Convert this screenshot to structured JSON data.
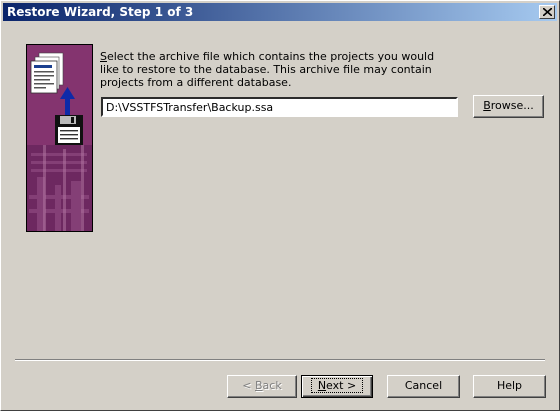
{
  "window": {
    "title": "Restore Wizard, Step 1 of 3"
  },
  "description": {
    "first_letter": "S",
    "text_rest": "elect the archive file which contains the projects you would like to restore to the database. This archive file may contain projects from a different database."
  },
  "archive_path": {
    "value": "D:\\VSSTFSTransfer\\Backup.ssa"
  },
  "buttons": {
    "browse": {
      "mnemonic": "B",
      "rest": "rowse..."
    },
    "back": {
      "prefix": "< ",
      "mnemonic": "B",
      "rest": "ack"
    },
    "next": {
      "mnemonic": "N",
      "rest": "ext >"
    },
    "cancel": "Cancel",
    "help": "Help"
  },
  "icons": {
    "wizard_graphic": "archive-restore-illustration",
    "close": "close-icon"
  }
}
